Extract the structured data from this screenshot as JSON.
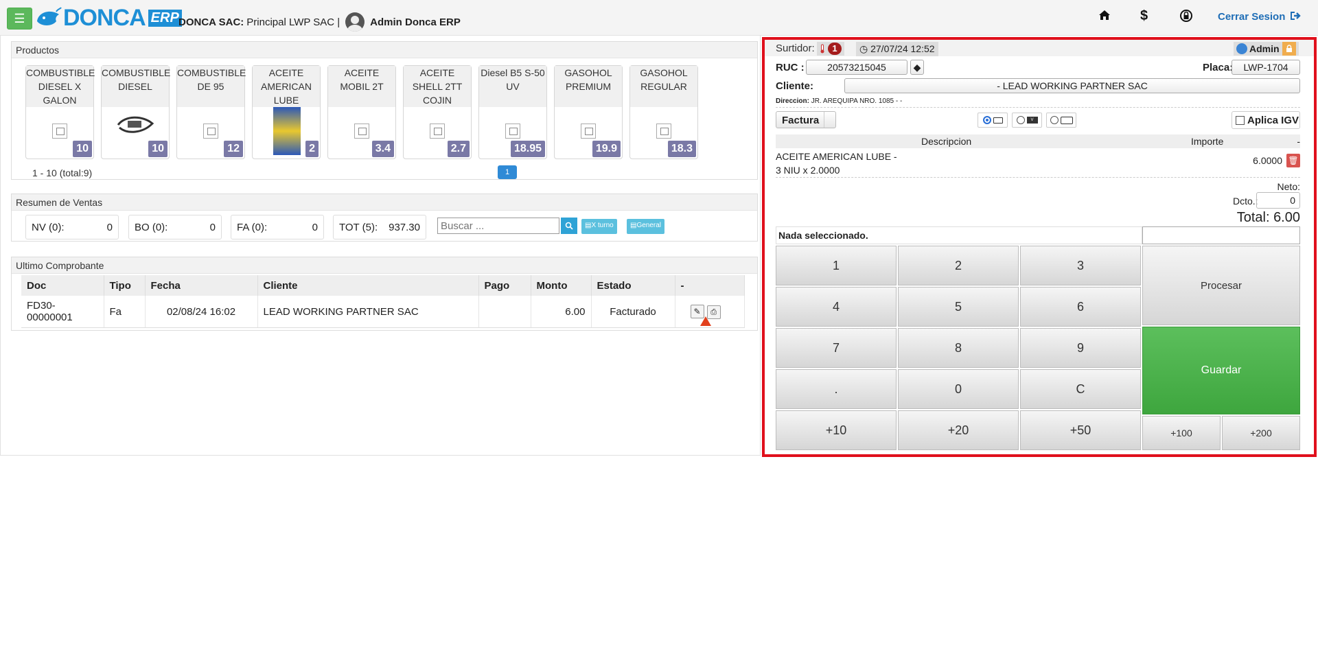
{
  "topbar": {
    "logo_text": "DONCA",
    "logo_suffix": "ERP",
    "company_label": "DONCA SAC:",
    "branch": "Principal LWP SAC |",
    "user": "Admin Donca ERP",
    "logout": "Cerrar Sesion",
    "menu_icon": "☰",
    "home_icon": "⌂",
    "dollar_icon": "$",
    "lock_icon": "🔒"
  },
  "productos": {
    "title": "Productos",
    "items": [
      {
        "name": "COMBUSTIBLE DIESEL X GALON",
        "price": "10"
      },
      {
        "name": "COMBUSTIBLE DIESEL",
        "price": "10"
      },
      {
        "name": "COMBUSTIBLE DE 95",
        "price": "12"
      },
      {
        "name": "ACEITE AMERICAN LUBE",
        "price": "2"
      },
      {
        "name": "ACEITE MOBIL 2T",
        "price": "3.4"
      },
      {
        "name": "ACEITE SHELL 2TT COJIN",
        "price": "2.7"
      },
      {
        "name": "Diesel B5 S-50 UV",
        "price": "18.95"
      },
      {
        "name": "GASOHOL PREMIUM",
        "price": "19.9"
      },
      {
        "name": "GASOHOL REGULAR",
        "price": "18.3"
      }
    ],
    "pager_text": "1 - 10 (total:9)",
    "page": "1"
  },
  "resumen": {
    "title": "Resumen de Ventas",
    "nv_label": "NV (0):",
    "nv_value": "0",
    "bo_label": "BO (0):",
    "bo_value": "0",
    "fa_label": "FA (0):",
    "fa_value": "0",
    "tot_label": "TOT (5):",
    "tot_value": "937.30",
    "search_placeholder": "Buscar ...",
    "xturno": "X turno",
    "general": "General"
  },
  "ultimo": {
    "title": "Ultimo Comprobante",
    "columns": [
      "Doc",
      "Tipo",
      "Fecha",
      "Cliente",
      "Pago",
      "Monto",
      "Estado",
      "-"
    ],
    "row": {
      "doc": "FD30-00000001",
      "tipo": "Fa",
      "fecha": "02/08/24 16:02",
      "cliente": "LEAD WORKING PARTNER SAC",
      "pago": "",
      "monto": "6.00",
      "estado": "Facturado"
    }
  },
  "venta": {
    "surtidor_label": "Surtidor:",
    "surtidor_badge": "1",
    "datetime": "27/07/24 12:52",
    "admin": "Admin",
    "ruc_label": "RUC :",
    "ruc_value": "20573215045",
    "placa_label": "Placa:",
    "placa_value": "LWP-1704",
    "cliente_label": "Cliente:",
    "cliente_value": "- LEAD WORKING PARTNER SAC",
    "direccion_label": "Direccion:",
    "direccion_value": "JR. AREQUIPA NRO. 1085 - -",
    "tipo_doc": "Factura",
    "aplica_igv": "Aplica IGV",
    "col_desc": "Descripcion",
    "col_importe": "Importe",
    "col_dash": "-",
    "item_line1": "ACEITE AMERICAN LUBE -",
    "item_line2": "3 NIU x 2.0000",
    "item_importe": "6.0000",
    "neto_label": "Neto:",
    "dcto_label": "Dcto.:",
    "dcto_value": "0",
    "total": "Total: 6.00",
    "nada": "Nada seleccionado."
  },
  "keypad": {
    "k1": "1",
    "k2": "2",
    "k3": "3",
    "k4": "4",
    "k5": "5",
    "k6": "6",
    "k7": "7",
    "k8": "8",
    "k9": "9",
    "kdot": ".",
    "k0": "0",
    "kc": "C",
    "p10": "+10",
    "p20": "+20",
    "p50": "+50",
    "p100": "+100",
    "p200": "+200",
    "procesar": "Procesar",
    "guardar": "Guardar"
  }
}
